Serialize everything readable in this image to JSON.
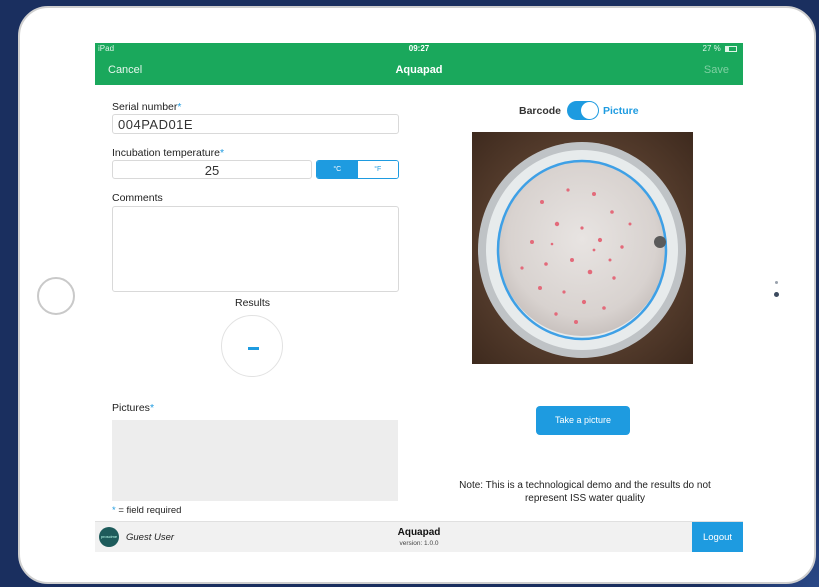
{
  "status_bar": {
    "device": "iPad",
    "time": "09:27",
    "battery": "27 %"
  },
  "nav": {
    "cancel": "Cancel",
    "title": "Aquapad",
    "save": "Save"
  },
  "form": {
    "serial_label": "Serial number",
    "serial_value": "004PAD01E",
    "temp_label": "Incubation temperature",
    "temp_value": "25",
    "unit_c": "°C",
    "unit_f": "°F",
    "comments_label": "Comments",
    "comments_value": "",
    "results_label": "Results",
    "pictures_label": "Pictures",
    "required_mark": "*",
    "required_note": "= field required"
  },
  "mode_switch": {
    "left_label": "Barcode",
    "right_label": "Picture",
    "on": true
  },
  "actions": {
    "take_picture": "Take a picture"
  },
  "note": "Note: This is a technological demo and the results do not represent ISS water quality",
  "bottom": {
    "user": "Guest User",
    "app_name": "Aquapad",
    "version": "version: 1.0.0",
    "logout": "Logout",
    "avatar_text": "proscime"
  },
  "colors": {
    "green": "#1aa85c",
    "accent": "#1e9be0"
  }
}
